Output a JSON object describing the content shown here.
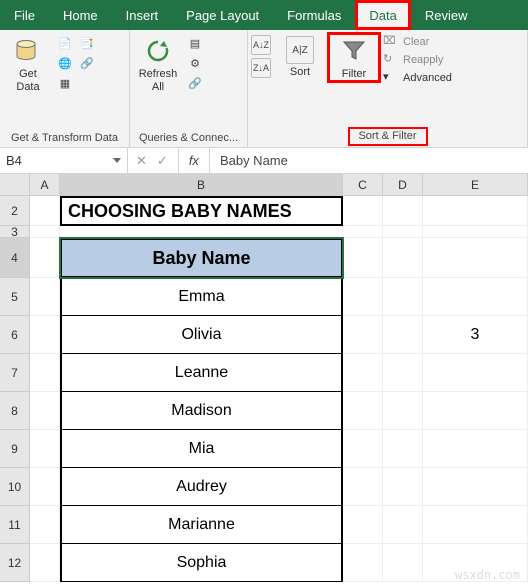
{
  "tabs": {
    "file": "File",
    "home": "Home",
    "insert": "Insert",
    "page_layout": "Page Layout",
    "formulas": "Formulas",
    "data": "Data",
    "review": "Review"
  },
  "ribbon": {
    "get_data": "Get\nData",
    "refresh_all": "Refresh\nAll",
    "sort": "Sort",
    "filter": "Filter",
    "az": "A↓Z",
    "za": "Z↓A",
    "clear": "Clear",
    "reapply": "Reapply",
    "advanced": "Advanced",
    "group1": "Get & Transform Data",
    "group2": "Queries & Connec...",
    "group3": "Sort & Filter"
  },
  "namebox": "B4",
  "formula": "Baby Name",
  "fx": "fx",
  "columns": {
    "A": "A",
    "B": "B",
    "C": "C",
    "D": "D",
    "E": "E"
  },
  "rows": [
    "2",
    "3",
    "4",
    "5",
    "6",
    "7",
    "8",
    "9",
    "10",
    "11",
    "12"
  ],
  "title": "CHOOSING BABY NAMES",
  "header": "Baby Name",
  "names": [
    "Emma",
    "Olivia",
    "Leanne",
    "Madison",
    "Mia",
    "Audrey",
    "Marianne",
    "Sophia"
  ],
  "extra_value": "3",
  "watermark": "wsxdn.com",
  "chart_data": {
    "type": "table",
    "title": "CHOOSING BABY NAMES",
    "columns": [
      "Baby Name"
    ],
    "rows": [
      [
        "Emma"
      ],
      [
        "Olivia"
      ],
      [
        "Leanne"
      ],
      [
        "Madison"
      ],
      [
        "Mia"
      ],
      [
        "Audrey"
      ],
      [
        "Marianne"
      ],
      [
        "Sophia"
      ]
    ],
    "extra": {
      "cell": "E6",
      "value": 3
    }
  }
}
